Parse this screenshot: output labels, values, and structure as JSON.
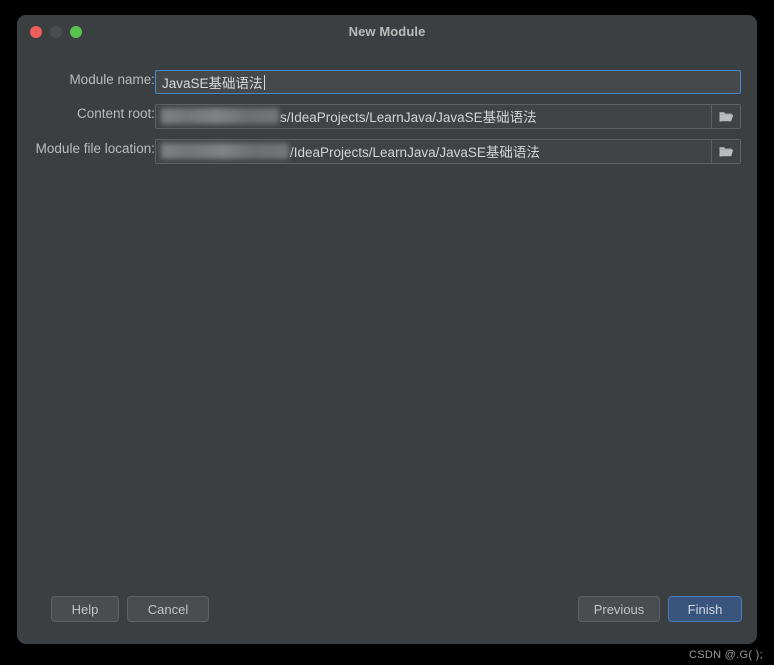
{
  "window": {
    "title": "New Module",
    "controls": {
      "close": "close-button",
      "minimize": "minimize-button",
      "maximize": "maximize-button"
    }
  },
  "form": {
    "module_name": {
      "label": "Module name:",
      "value": "JavaSE基础语法"
    },
    "content_root": {
      "label": "Content root:",
      "redacted_prefix": "",
      "value": "s/IdeaProjects/LearnJava/JavaSE基础语法",
      "browse_icon": "folder-open-icon"
    },
    "module_file_location": {
      "label": "Module file location:",
      "redacted_prefix": "",
      "value": "/IdeaProjects/LearnJava/JavaSE基础语法",
      "browse_icon": "folder-open-icon"
    }
  },
  "footer": {
    "help": "Help",
    "cancel": "Cancel",
    "previous": "Previous",
    "finish": "Finish"
  },
  "watermark": "CSDN @.G( );",
  "colors": {
    "dialog_bg": "#3c3f41",
    "focus_border": "#4a88c7",
    "primary_button_bg": "#38547d",
    "traffic_close": "#ec5f5b",
    "traffic_minimize": "#4a4d4f",
    "traffic_maximize": "#5ac24f",
    "text": "#bbbbbb"
  }
}
